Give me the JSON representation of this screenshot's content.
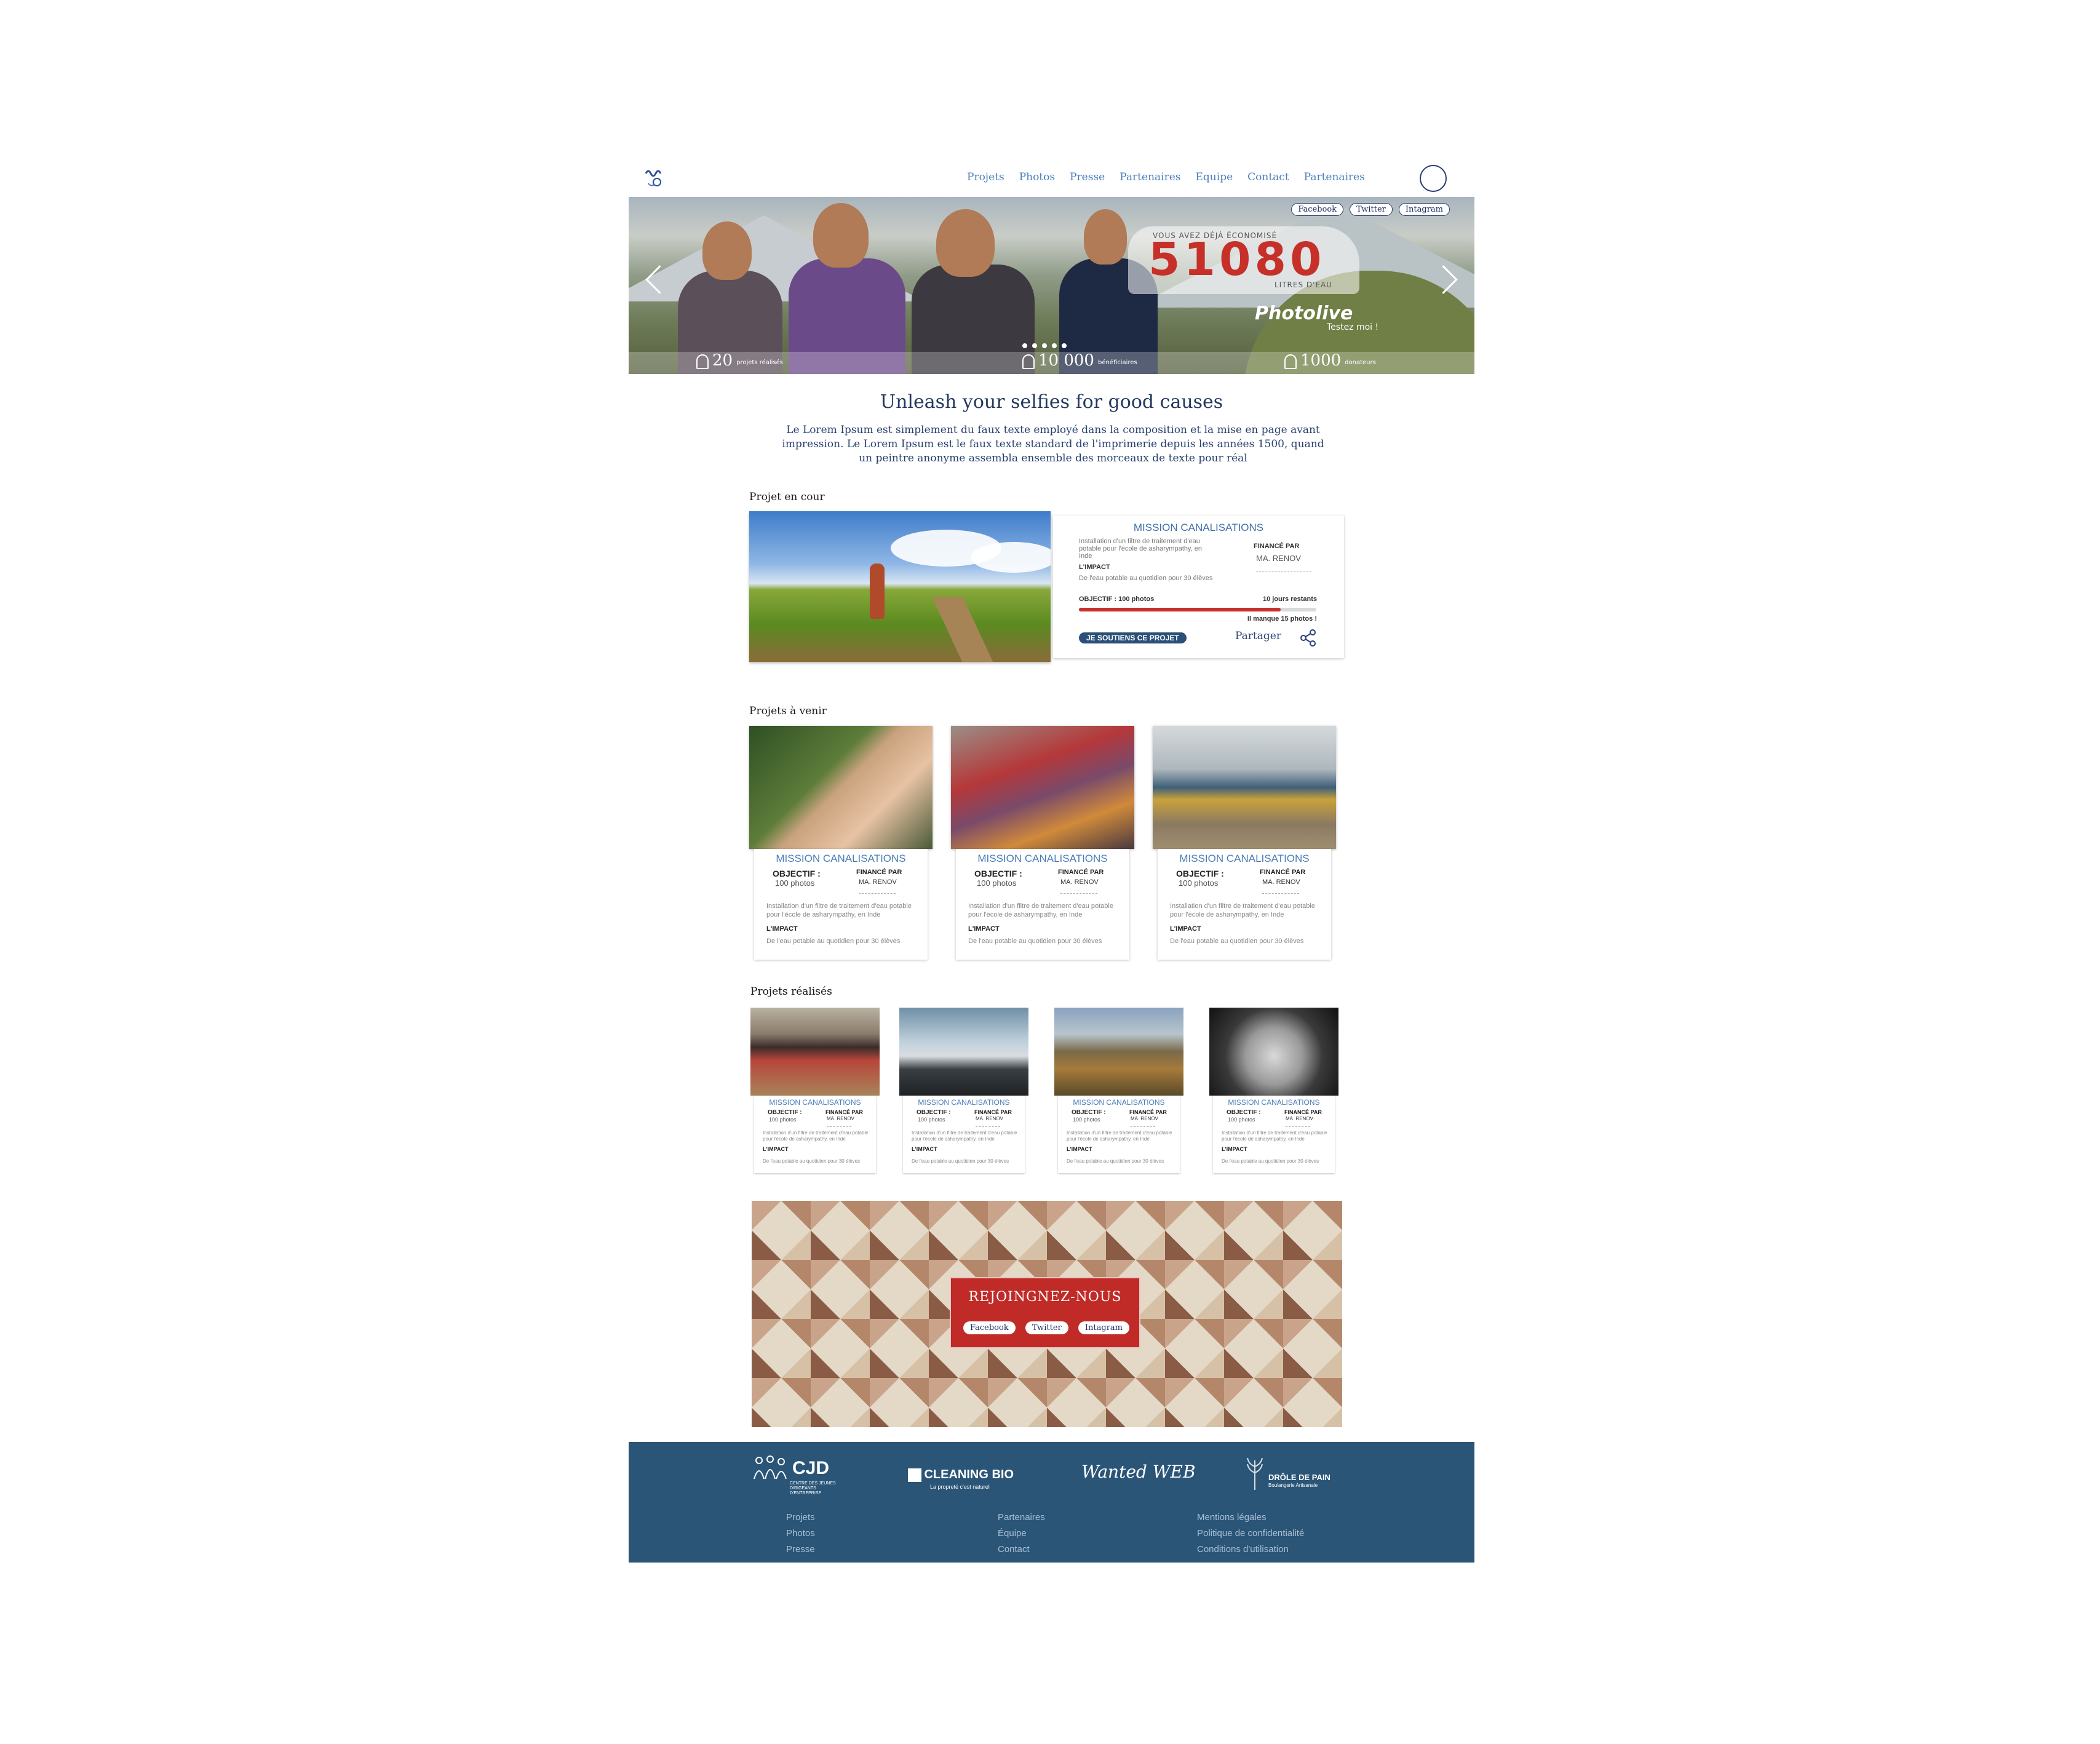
{
  "nav": {
    "items": [
      "Projets",
      "Photos",
      "Presse",
      "Partenaires",
      "Equipe",
      "Contact",
      "Partenaires"
    ]
  },
  "hero": {
    "social": [
      "Facebook",
      "Twitter",
      "Intagram"
    ],
    "counter_label": "VOUS AVEZ DÉJÀ ÉCONOMISÉ",
    "counter_value": "51080",
    "counter_unit": "LITRES D'EAU",
    "photolive": "Photolive",
    "photolive_sub": "Testez moi !",
    "slide_count": 5,
    "stats": [
      {
        "num": "20",
        "label": "projets réalisés"
      },
      {
        "num": "10 000",
        "label": "bénéficiaires"
      },
      {
        "num": "1000",
        "label": "donateurs"
      }
    ]
  },
  "intro": {
    "title": "Unleash your selfies for good causes",
    "text": "Le Lorem Ipsum est simplement du faux texte employé dans la composition et la mise en page avant impression. Le Lorem Ipsum est le faux texte standard de l'imprimerie depuis les années 1500, quand un peintre anonyme assembla ensemble des morceaux de texte pour réal"
  },
  "current": {
    "section_title": "Projet en cour",
    "title": "MISSION CANALISATIONS",
    "description": "Installation d'un filtre de traitement d'eau potable pour l'école de asharympathy, en Inde",
    "funded_label": "FINANCÉ PAR",
    "funder": "MA. RENOV",
    "impact_label": "L'IMPACT",
    "impact_text": "De l'eau potable au quotidien pour 30 élèves",
    "objective": "OBJECTIF : 100 photos",
    "days_left": "10 jours restants",
    "progress": 0.85,
    "missing": "Il manque 15 photos !",
    "cta": "JE SOUTIENS CE PROJET",
    "share": "Partager",
    "accent": "#c8302c"
  },
  "upcoming": {
    "section_title": "Projets à venir",
    "cards": [
      {
        "title": "MISSION CANALISATIONS",
        "objective_label": "OBJECTIF :",
        "objective_value": "100 photos",
        "funded_label": "FINANCÉ PAR",
        "funder": "MA. RENOV",
        "description": "Installation d'un filtre de traitement d'eau potable pour l'école de asharympathy, en Inde",
        "impact_label": "L'IMPACT",
        "impact_text": "De l'eau potable au quotidien pour 30 élèves"
      },
      {
        "title": "MISSION CANALISATIONS",
        "objective_label": "OBJECTIF :",
        "objective_value": "100 photos",
        "funded_label": "FINANCÉ PAR",
        "funder": "MA. RENOV",
        "description": "Installation d'un filtre de traitement d'eau potable pour l'école de asharympathy, en Inde",
        "impact_label": "L'IMPACT",
        "impact_text": "De l'eau potable au quotidien pour 30 élèves"
      },
      {
        "title": "MISSION CANALISATIONS",
        "objective_label": "OBJECTIF :",
        "objective_value": "100 photos",
        "funded_label": "FINANCÉ PAR",
        "funder": "MA. RENOV",
        "description": "Installation d'un filtre de traitement d'eau potable pour l'école de asharympathy, en Inde",
        "impact_label": "L'IMPACT",
        "impact_text": "De l'eau potable au quotidien pour 30 élèves"
      }
    ]
  },
  "done": {
    "section_title": "Projets réalisés",
    "cards": [
      {
        "title": "MISSION CANALISATIONS",
        "objective_label": "OBJECTIF :",
        "objective_value": "100 photos",
        "funded_label": "FINANCÉ PAR",
        "funder": "MA. RENOV",
        "description": "Installation d'un filtre de traitement d'eau potable pour l'école de asharympathy, en Inde",
        "impact_label": "L'IMPACT",
        "impact_text": "De l'eau potable au quotidien pour 30 élèves"
      },
      {
        "title": "MISSION CANALISATIONS",
        "objective_label": "OBJECTIF :",
        "objective_value": "100 photos",
        "funded_label": "FINANCÉ PAR",
        "funder": "MA. RENOV",
        "description": "Installation d'un filtre de traitement d'eau potable pour l'école de asharympathy, en Inde",
        "impact_label": "L'IMPACT",
        "impact_text": "De l'eau potable au quotidien pour 30 élèves"
      },
      {
        "title": "MISSION CANALISATIONS",
        "objective_label": "OBJECTIF :",
        "objective_value": "100 photos",
        "funded_label": "FINANCÉ PAR",
        "funder": "MA. RENOV",
        "description": "Installation d'un filtre de traitement d'eau potable pour l'école de asharympathy, en Inde",
        "impact_label": "L'IMPACT",
        "impact_text": "De l'eau potable au quotidien pour 30 élèves"
      },
      {
        "title": "MISSION CANALISATIONS",
        "objective_label": "OBJECTIF :",
        "objective_value": "100 photos",
        "funded_label": "FINANCÉ PAR",
        "funder": "MA. RENOV",
        "description": "Installation d'un filtre de traitement d'eau potable pour l'école de asharympathy, en Inde",
        "impact_label": "L'IMPACT",
        "impact_text": "De l'eau potable au quotidien pour 30 élèves"
      }
    ]
  },
  "join": {
    "title": "REJOINGNEZ-NOUS",
    "social": [
      "Facebook",
      "Twitter",
      "Intagram"
    ],
    "accent": "#c02a27"
  },
  "footer": {
    "partners": [
      {
        "name": "CJD",
        "sub": "CENTRE DES JEUNES DIRIGEANTS D'ENTREPRISE"
      },
      {
        "name": "CLEANING BIO",
        "sub": "La propreté c'est naturel"
      },
      {
        "name": "Wanted WEB",
        "sub": ""
      },
      {
        "name": "DRÔLE DE PAIN",
        "sub": "Boulangerie Artisanale"
      }
    ],
    "col1": [
      "Projets",
      "Photos",
      "Presse"
    ],
    "col2": [
      "Partenaires",
      "Équipe",
      "Contact"
    ],
    "col3": [
      "Mentions légales",
      "Politique de confidentialité",
      "Conditions d'utilisation"
    ],
    "background": "#2a5577"
  }
}
